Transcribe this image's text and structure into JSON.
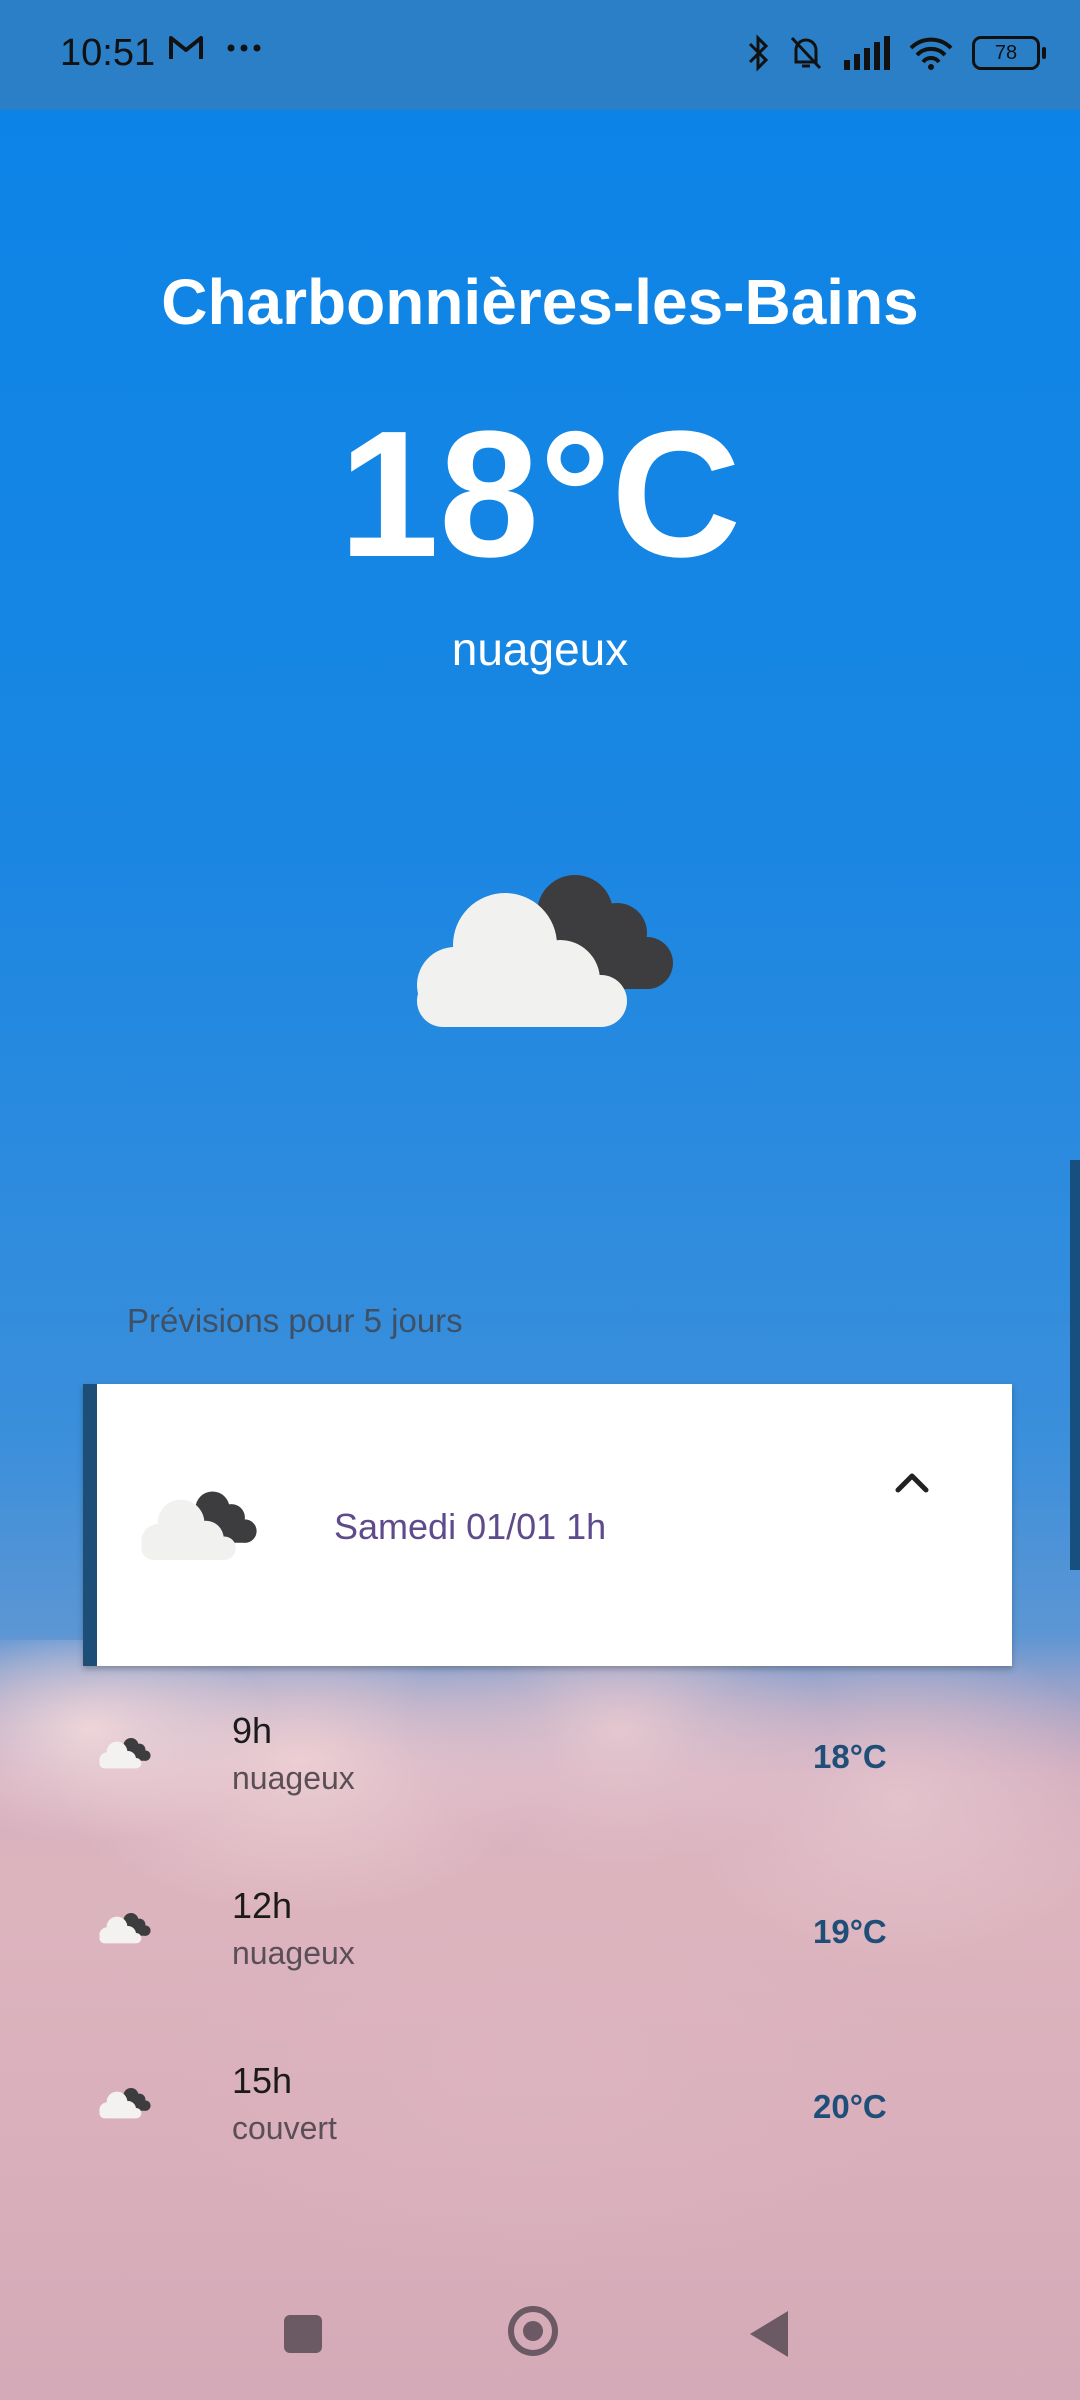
{
  "status_bar": {
    "time": "10:51",
    "battery": "78",
    "icons": [
      "gmail-icon",
      "more-dots-icon",
      "bluetooth-icon",
      "mute-bell-icon",
      "signal-icon",
      "wifi-icon",
      "battery-icon"
    ]
  },
  "current": {
    "city": "Charbonnières-les-Bains",
    "temperature": "18°C",
    "description": "nuageux",
    "icon": "cloudy-icon"
  },
  "forecast": {
    "title": "Prévisions pour 5 jours",
    "day_card": {
      "label": "Samedi 01/01 1h",
      "icon": "cloudy-icon",
      "expanded": true
    },
    "hours": [
      {
        "time": "9h",
        "desc": "nuageux",
        "temp": "18°C",
        "icon": "cloudy-icon"
      },
      {
        "time": "12h",
        "desc": "nuageux",
        "temp": "19°C",
        "icon": "cloudy-icon"
      },
      {
        "time": "15h",
        "desc": "couvert",
        "temp": "20°C",
        "icon": "cloudy-icon"
      }
    ]
  },
  "colors": {
    "sky_blue": "#0a84e8",
    "card_accent": "#1c4e78",
    "day_label": "#5e4b8b",
    "hour_temp": "#1f4f78"
  }
}
